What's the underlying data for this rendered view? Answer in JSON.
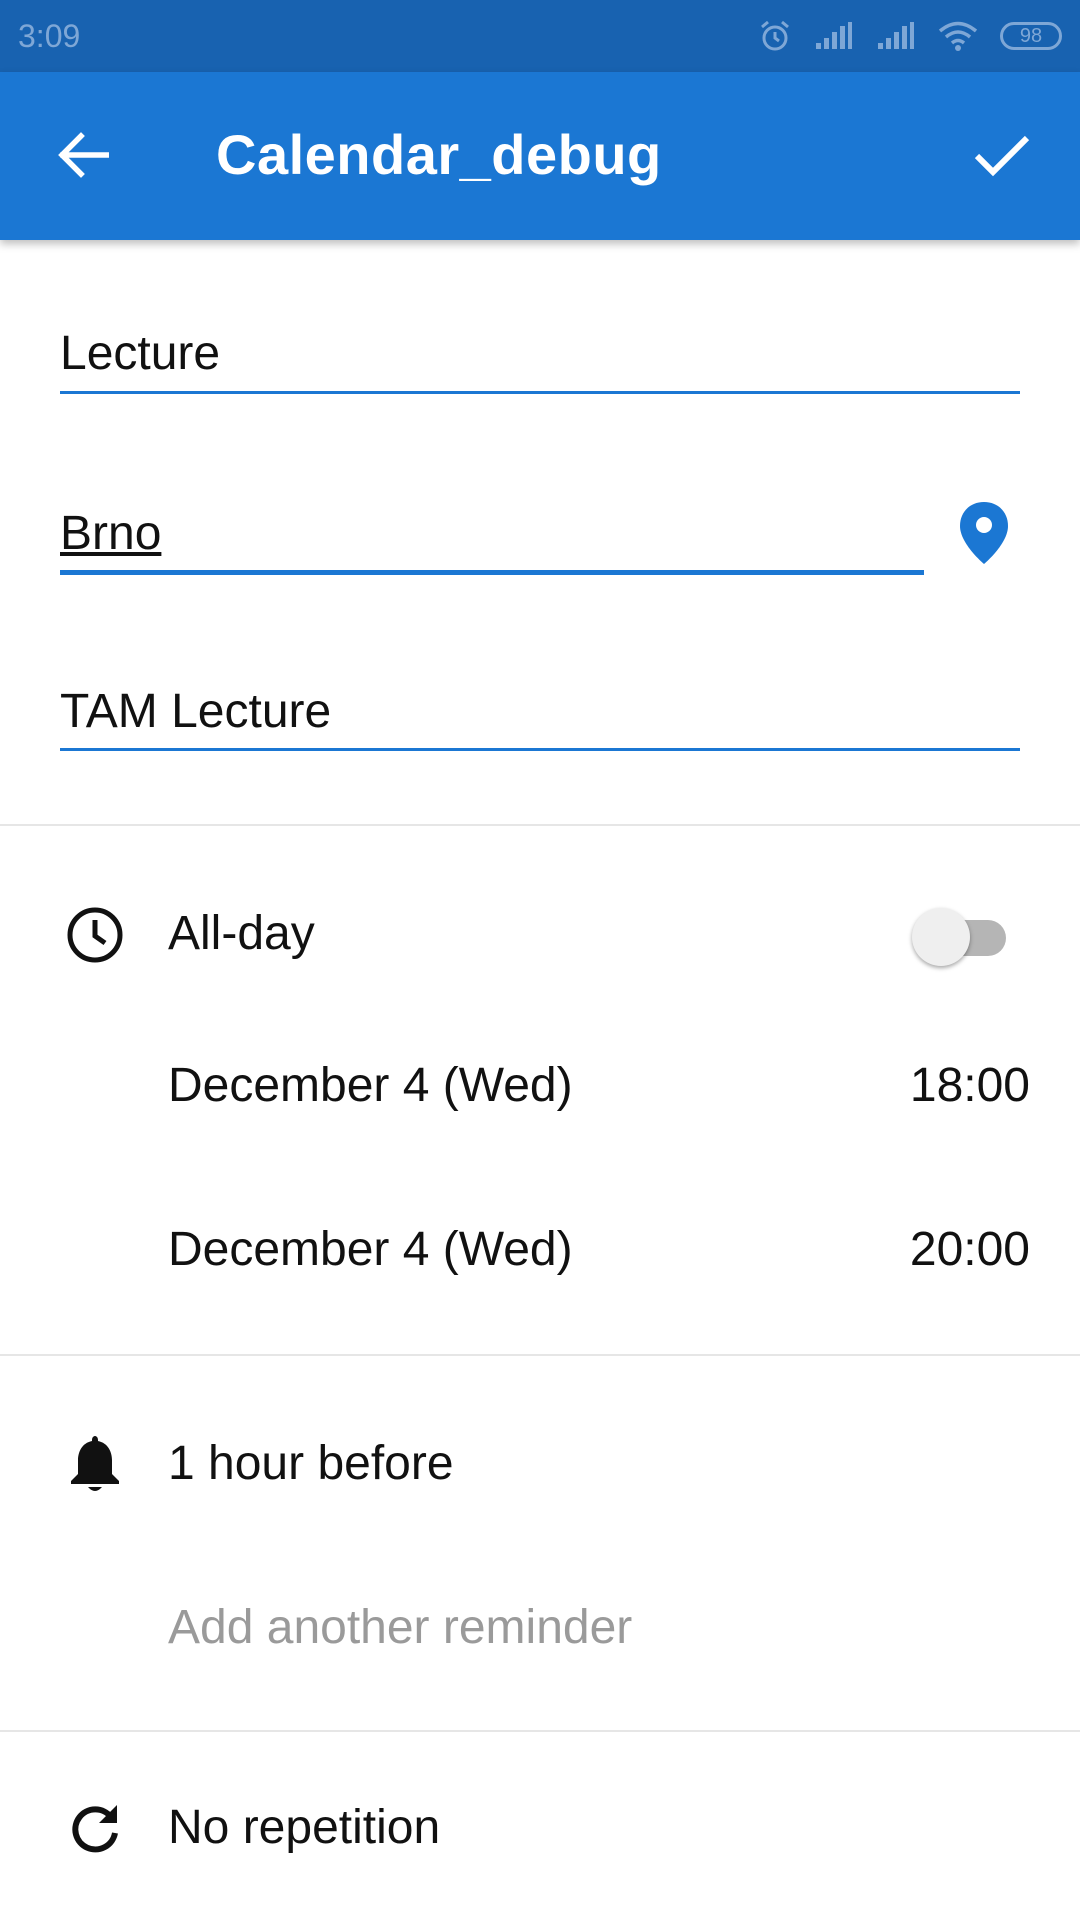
{
  "status_bar": {
    "time": "3:09",
    "battery": "98",
    "icons": [
      "alarm-icon",
      "signal-icon",
      "signal-icon",
      "wifi-icon",
      "battery-icon"
    ]
  },
  "app_bar": {
    "title": "Calendar_debug",
    "back_icon": "arrow-left-icon",
    "confirm_icon": "check-icon",
    "color": "#1b77d3"
  },
  "form": {
    "title_value": "Lecture",
    "location_value": "Brno",
    "description_value": "TAM Lecture",
    "location_icon": "location-pin-icon"
  },
  "time_section": {
    "all_day_label": "All-day",
    "all_day_enabled": false,
    "start_date": "December 4 (Wed)",
    "start_time": "18:00",
    "end_date": "December 4 (Wed)",
    "end_time": "20:00",
    "icon": "clock-icon"
  },
  "reminder_section": {
    "reminder": "1 hour before",
    "add_reminder": "Add another reminder",
    "icon": "bell-icon"
  },
  "repeat_section": {
    "label": "No repetition",
    "icon": "repeat-icon"
  },
  "colors": {
    "primary": "#1b77d3",
    "status_bar": "#1862b0",
    "hint": "#9a9a9a"
  }
}
